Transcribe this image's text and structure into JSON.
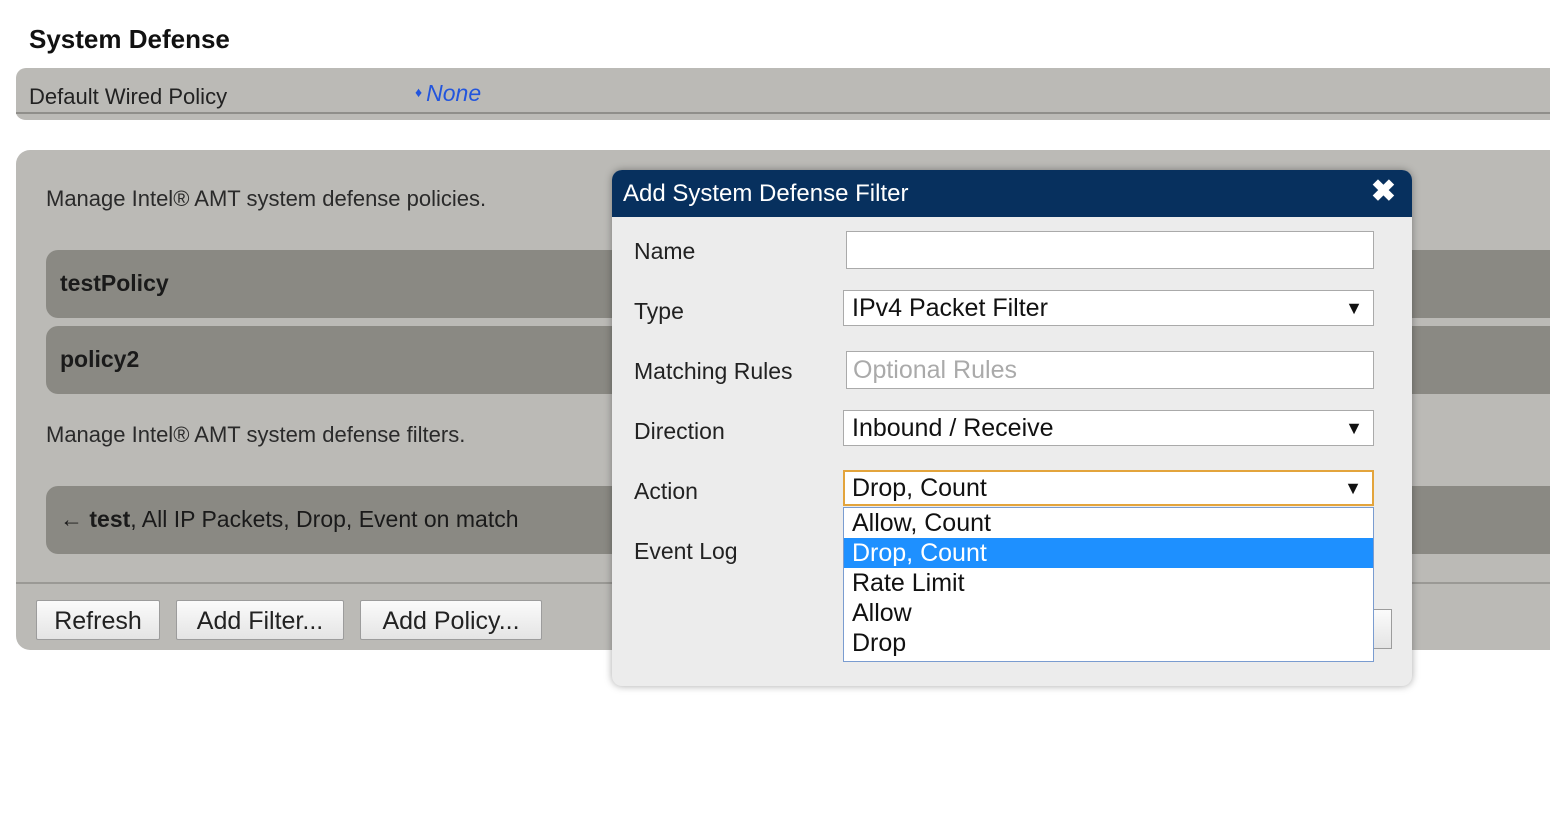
{
  "page": {
    "title": "System Defense"
  },
  "default_policy": {
    "label": "Default Wired Policy",
    "value": "None"
  },
  "panel": {
    "policies_desc": "Manage Intel® AMT system defense policies.",
    "policies": [
      {
        "name": "testPolicy"
      },
      {
        "name": "policy2"
      }
    ],
    "filters_desc": "Manage Intel® AMT system defense filters.",
    "filter_row": {
      "arrow": "←",
      "name": "test",
      "details": ", All IP Packets, Drop, Event on match"
    },
    "buttons": {
      "refresh": "Refresh",
      "add_filter": "Add Filter...",
      "add_policy": "Add Policy..."
    }
  },
  "dialog": {
    "title": "Add System Defense Filter",
    "close_glyph": "✖",
    "fields": {
      "name": {
        "label": "Name",
        "value": ""
      },
      "type": {
        "label": "Type",
        "value": "IPv4 Packet Filter"
      },
      "matching_rules": {
        "label": "Matching Rules",
        "placeholder": "Optional Rules",
        "value": ""
      },
      "direction": {
        "label": "Direction",
        "value": "Inbound / Receive"
      },
      "action": {
        "label": "Action",
        "value": "Drop, Count",
        "options": [
          "Allow, Count",
          "Drop, Count",
          "Rate Limit",
          "Allow",
          "Drop"
        ],
        "highlighted_index": 1
      },
      "event_log": {
        "label": "Event Log"
      }
    },
    "select_arrow": "▼"
  },
  "colors": {
    "header_bg": "#07305e",
    "panel_bg": "#bbbab6",
    "row_bg": "#8a8983",
    "highlight": "#1e90ff",
    "focus_border": "#e3a43c",
    "link_blue": "#2255dd"
  }
}
